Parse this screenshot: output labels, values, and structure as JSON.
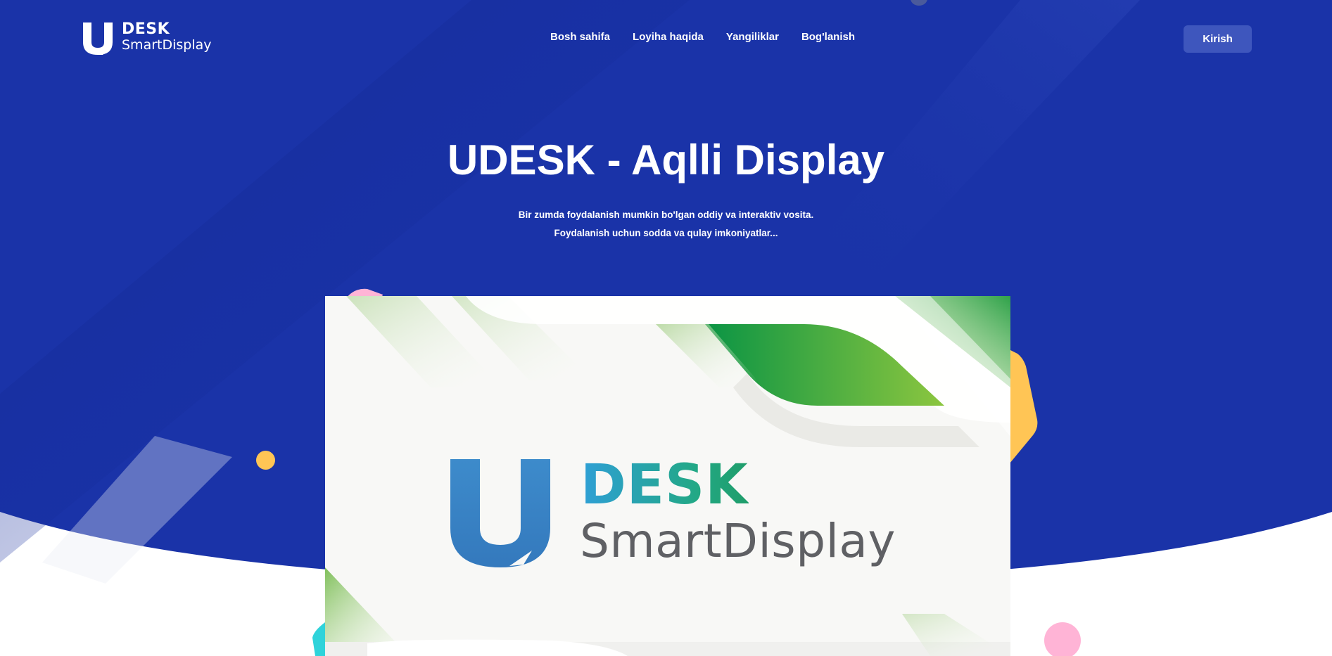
{
  "colors": {
    "hero_blue": "#1a33a8",
    "button_blue": "#3e56bd",
    "accent_yellow": "#ffc555",
    "accent_pink": "#ffb4d6",
    "accent_cyan": "#2fd3da",
    "brand_green": "#4caf50",
    "brand_blue": "#3b88c8",
    "text_gray": "#5f6064"
  },
  "header": {
    "logo": {
      "line1": "DESK",
      "line2": "SmartDisplay",
      "icon": "udesk-logo-icon"
    },
    "nav": [
      {
        "label": "Bosh sahifa"
      },
      {
        "label": "Loyiha haqida"
      },
      {
        "label": "Yangiliklar"
      },
      {
        "label": "Bog'lanish"
      }
    ],
    "login_label": "Kirish"
  },
  "hero": {
    "title": "UDESK - Aqlli Display",
    "subtitle_line1": "Bir zumda foydalanish mumkin bo'lgan oddiy va interaktiv vosita.",
    "subtitle_line2": "Foydalanish uchun sodda va qulay imkoniyatlar..."
  },
  "banner": {
    "brand_line1": "DESK",
    "brand_line2": "SmartDisplay",
    "icon": "udesk-logo-icon"
  }
}
